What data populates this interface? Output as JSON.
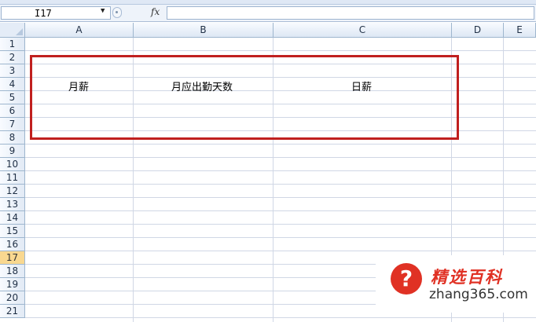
{
  "formula_bar": {
    "name_box_value": "I17",
    "fx_label": "fx",
    "formula_value": ""
  },
  "columns": [
    "A",
    "B",
    "C",
    "D",
    "E"
  ],
  "rows": [
    "1",
    "2",
    "3",
    "4",
    "5",
    "6",
    "7",
    "8",
    "9",
    "10",
    "11",
    "12",
    "13",
    "14",
    "15",
    "16",
    "17",
    "18",
    "19",
    "20",
    "21"
  ],
  "selected_row": "17",
  "cells": {
    "A4": "月薪",
    "B4": "月应出勤天数",
    "C4": "日薪"
  },
  "annotation": {
    "box_color": "#c0201f"
  },
  "watermark": {
    "icon": "question-mark-icon",
    "glyph": "?",
    "title": "精选百科",
    "site": "zhang365.com",
    "color": "#e03124"
  }
}
